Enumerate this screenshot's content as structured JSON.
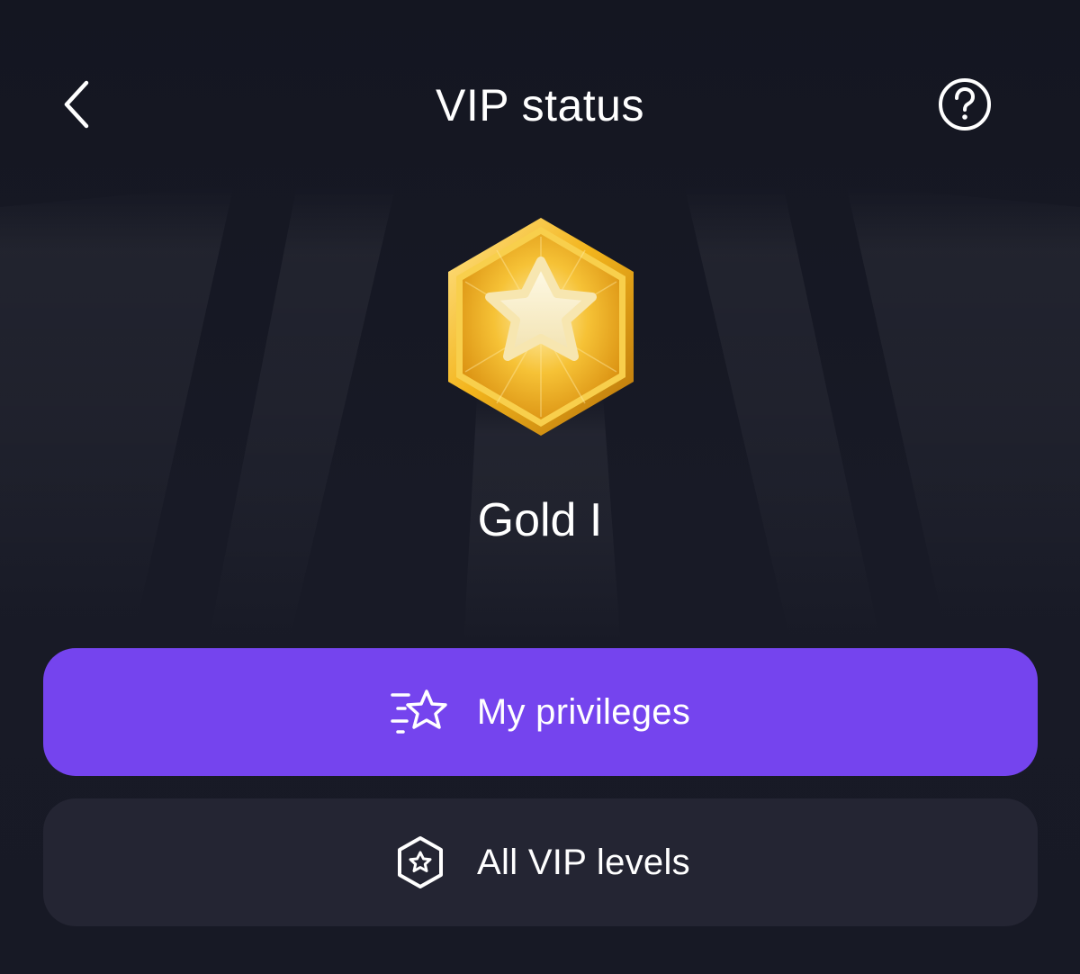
{
  "header": {
    "title": "VIP status",
    "back_icon": "chevron-left-icon",
    "help_icon": "question-circle-icon"
  },
  "status": {
    "level_name": "Gold I",
    "badge_icon": "gold-hexagon-star-badge"
  },
  "actions": {
    "primary_label": "My privileges",
    "primary_icon": "star-speed-icon",
    "secondary_label": "All VIP levels",
    "secondary_icon": "hexagon-star-icon"
  },
  "colors": {
    "background": "#161823",
    "primary_button": "#7544ee",
    "secondary_button": "#242533",
    "badge_gold": "#f2b524",
    "star": "#fbf2d2"
  }
}
